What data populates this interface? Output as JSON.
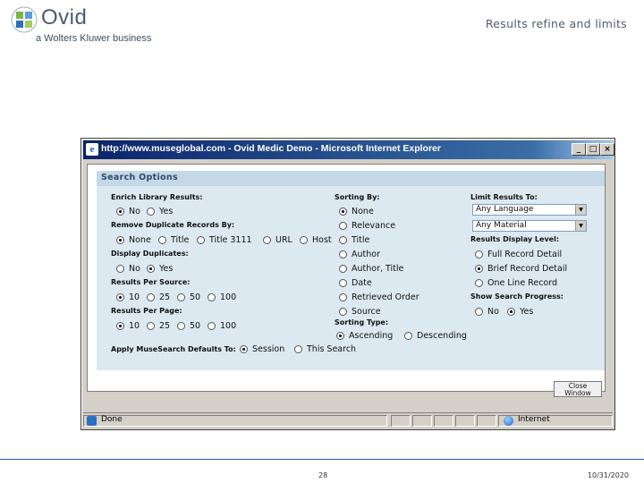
{
  "slide": {
    "logo_text": "Ovid",
    "logo_tagline": "a Wolters Kluwer business",
    "title": "Results refine and limits",
    "page_number": "28",
    "date": "10/31/2020"
  },
  "browser": {
    "title": "http://www.museglobal.com - Ovid Medic Demo - Microsoft Internet Explorer",
    "controls": {
      "minimize": "_",
      "maximize": "□",
      "close": "×"
    },
    "status_text": "Done",
    "zone_text": "Internet"
  },
  "search_options": {
    "header": "Search Options",
    "enrich": {
      "label": "Enrich Library Results:",
      "options": [
        "No",
        "Yes"
      ],
      "selected": "No"
    },
    "duplicates": {
      "label": "Remove Duplicate Records By:",
      "options": [
        "None",
        "Title",
        "Title 3111",
        "URL",
        "Host"
      ],
      "selected": "None"
    },
    "display_duplicates": {
      "label": "Display Duplicates:",
      "options": [
        "No",
        "Yes"
      ],
      "selected": "Yes"
    },
    "results_per_source": {
      "label": "Results Per Source:",
      "options": [
        "10",
        "25",
        "50",
        "100"
      ],
      "selected": "10"
    },
    "results_per_page": {
      "label": "Results Per Page:",
      "options": [
        "10",
        "25",
        "50",
        "100"
      ],
      "selected": "10"
    },
    "apply_defaults": {
      "label": "Apply MuseSearch Defaults To:",
      "options": [
        "Session",
        "This Search"
      ],
      "selected": "Session"
    },
    "sorting_by": {
      "label": "Sorting By:",
      "options": [
        "None",
        "Relevance",
        "Title",
        "Author",
        "Author, Title",
        "Date",
        "Retrieved Order",
        "Source"
      ],
      "selected": "None"
    },
    "sorting_type": {
      "label": "Sorting Type:",
      "options": [
        "Ascending",
        "Descending"
      ],
      "selected": "Ascending"
    },
    "limit_results": {
      "label": "Limit Results To:",
      "language": "Any Language",
      "material": "Any Material"
    },
    "display_level": {
      "label": "Results Display Level:",
      "options": [
        "Full Record Detail",
        "Brief Record Detail",
        "One Line Record"
      ],
      "selected": "Brief Record Detail"
    },
    "show_progress": {
      "label": "Show Search Progress:",
      "options": [
        "No",
        "Yes"
      ],
      "selected": "Yes"
    },
    "close_button": {
      "line1": "Close",
      "line2": "Window"
    }
  }
}
